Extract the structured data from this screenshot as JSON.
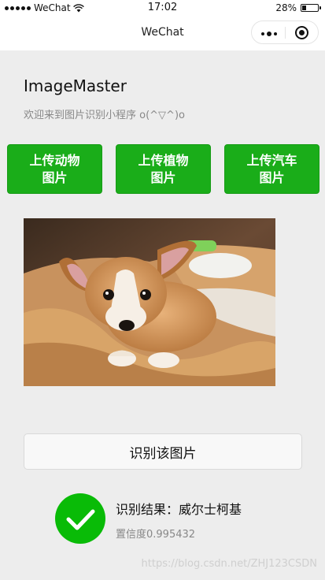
{
  "status_bar": {
    "carrier": "WeChat",
    "time": "17:02",
    "battery": "28%",
    "battery_level": 0.28
  },
  "nav": {
    "title": "WeChat",
    "capsule_icons": [
      "more-icon",
      "close-icon"
    ]
  },
  "header": {
    "title": "ImageMaster",
    "subtitle": "欢迎来到图片识别小程序 o(^▽^)o"
  },
  "upload_buttons": [
    {
      "label": "上传动物\n图片"
    },
    {
      "label": "上传植物\n图片"
    },
    {
      "label": "上传汽车\n图片"
    }
  ],
  "colors": {
    "accent_green": "#1aad19",
    "background": "#ededed"
  },
  "recognize_button": {
    "label": "识别该图片"
  },
  "result": {
    "label": "识别结果：威尔士柯基",
    "confidence": "置信度0.995432",
    "icon": "success-check-icon"
  },
  "watermark": "https://blog.csdn.net/ZHJ123CSDN"
}
